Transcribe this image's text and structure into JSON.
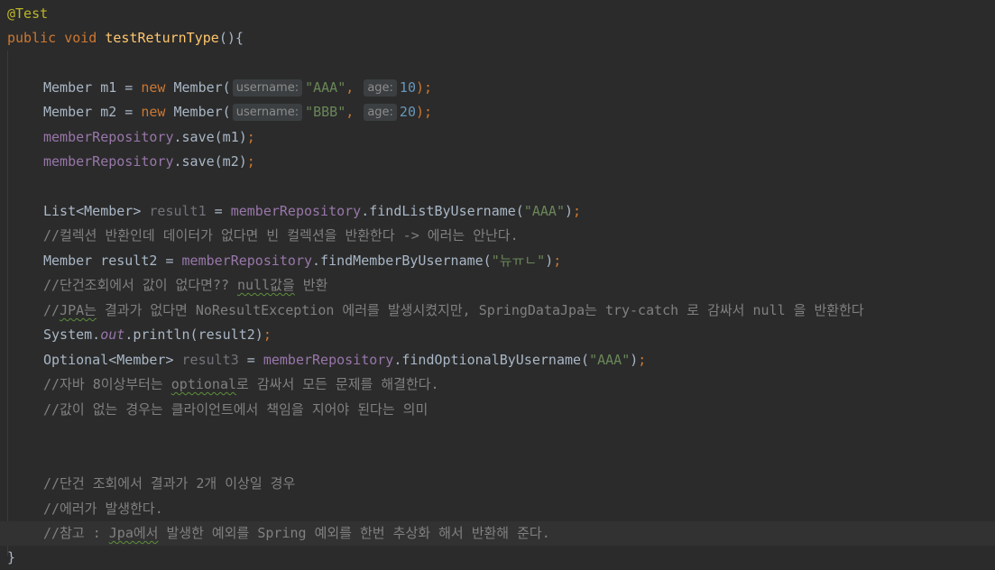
{
  "code": {
    "annotation": "@Test",
    "method_kw_public": "public",
    "method_kw_void": "void",
    "method_name": "testReturnType",
    "method_open": "(){",
    "l_m1_type": "Member m1 = ",
    "l_m1_new": "new",
    "l_m1_ctor": " Member(",
    "l_m1_hint1": "username:",
    "l_m1_str": "\"AAA\"",
    "l_m1_comma": ", ",
    "l_m1_hint2": "age:",
    "l_m1_num": "10",
    "l_m1_end": ");",
    "l_m2_type": "Member m2 = ",
    "l_m2_new": "new",
    "l_m2_ctor": " Member(",
    "l_m2_hint1": "username:",
    "l_m2_str": "\"BBB\"",
    "l_m2_comma": ", ",
    "l_m2_hint2": "age:",
    "l_m2_num": "20",
    "l_m2_end": ");",
    "l_save1_repo": "memberRepository",
    "l_save1_rest": ".save(m1)",
    "l_save1_semi": ";",
    "l_save2_repo": "memberRepository",
    "l_save2_rest": ".save(m2)",
    "l_save2_semi": ";",
    "l_r1_type": "List<Member> ",
    "l_r1_var": "result1",
    "l_r1_eq": " = ",
    "l_r1_repo": "memberRepository",
    "l_r1_call": ".findListByUsername(",
    "l_r1_str": "\"AAA\"",
    "l_r1_close": ")",
    "l_r1_semi": ";",
    "c1": "//컬렉션 반환인데 데이터가 없다면 빈 컬렉션을 반환한다 -> 에러는 안난다.",
    "l_r2_type": "Member result2 = ",
    "l_r2_repo": "memberRepository",
    "l_r2_call": ".findMemberByUsername(",
    "l_r2_str": "\"뉴ㅠㄴ\"",
    "l_r2_close": ")",
    "l_r2_semi": ";",
    "c2_a": "//단건조회에서 값이 없다면?? ",
    "c2_b": "null값을",
    "c2_c": " 반환",
    "c3_a": "//",
    "c3_b": "JPA는",
    "c3_c": " 결과가 없다면 NoResultException 에러를 발생시켰지만, SpringDataJpa는 try-catch 로 감싸서 null 을 반환한다",
    "l_sys_a": "System.",
    "l_sys_out": "out",
    "l_sys_b": ".println(result2)",
    "l_sys_semi": ";",
    "l_r3_type": "Optional<Member> ",
    "l_r3_var": "result3",
    "l_r3_eq": " = ",
    "l_r3_repo": "memberRepository",
    "l_r3_call": ".findOptionalByUsername(",
    "l_r3_str": "\"AAA\"",
    "l_r3_close": ")",
    "l_r3_semi": ";",
    "c4_a": "//자바 8이상부터는 ",
    "c4_b": "optional",
    "c4_c": "로 감싸서 모든 문제를 해결한다.",
    "c5": "//값이 없는 경우는 클라이언트에서 책임을 지어야 된다는 의미",
    "c6": "//단건 조회에서 결과가 2개 이상일 경우",
    "c7": "//에러가 발생한다.",
    "c8_a": "//참고 : ",
    "c8_b": "Jpa에서",
    "c8_c": " 발생한 예외를 Spring 예외를 한번 추상화 해서 반환해 준다.",
    "close_brace": "}"
  },
  "colors": {
    "background": "#2b2b2b",
    "keyword": "#cc7832",
    "method": "#ffc66d",
    "field": "#9876aa",
    "string": "#6a8759",
    "number": "#6897bb",
    "comment": "#808080",
    "annotation": "#bbb529",
    "current_line": "#323232"
  }
}
